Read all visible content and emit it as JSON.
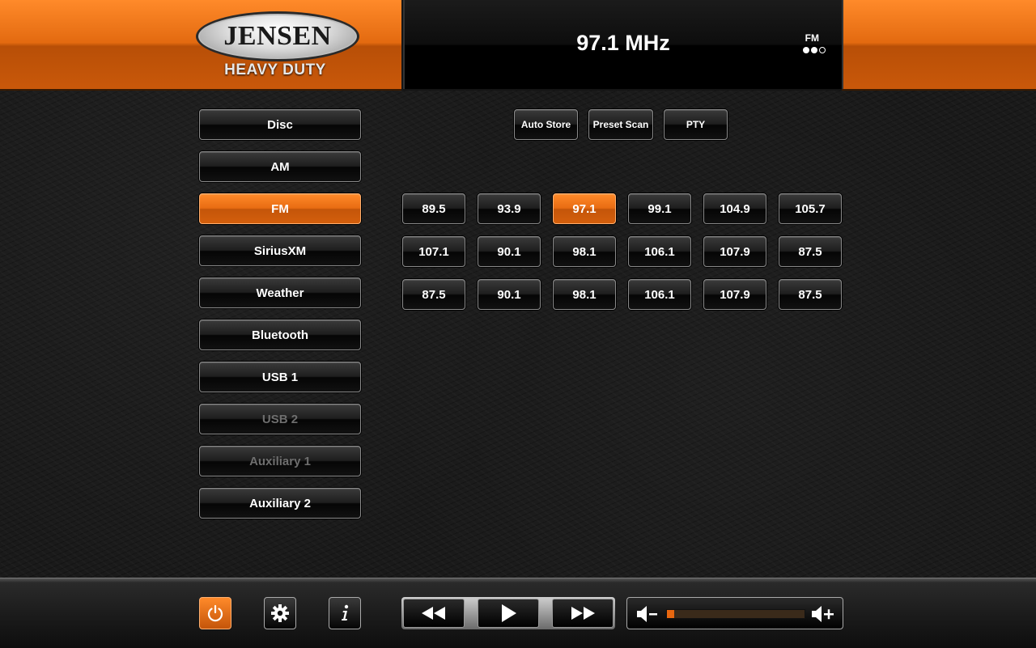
{
  "brand": {
    "name": "JENSEN",
    "subtitle": "HEAVY DUTY"
  },
  "display": {
    "frequency": "97.1 MHz",
    "band": "FM",
    "band_dots": [
      true,
      true,
      false
    ]
  },
  "sources": [
    {
      "label": "Disc",
      "state": "normal"
    },
    {
      "label": "AM",
      "state": "normal"
    },
    {
      "label": "FM",
      "state": "active"
    },
    {
      "label": "SiriusXM",
      "state": "normal"
    },
    {
      "label": "Weather",
      "state": "normal"
    },
    {
      "label": "Bluetooth",
      "state": "normal"
    },
    {
      "label": "USB 1",
      "state": "normal"
    },
    {
      "label": "USB 2",
      "state": "disabled"
    },
    {
      "label": "Auxiliary 1",
      "state": "disabled"
    },
    {
      "label": "Auxiliary 2",
      "state": "normal"
    }
  ],
  "tuner_buttons": {
    "auto_store": "Auto Store",
    "preset_scan": "Preset Scan",
    "pty": "PTY"
  },
  "presets": [
    [
      "89.5",
      "93.9",
      "97.1",
      "99.1",
      "104.9",
      "105.7"
    ],
    [
      "107.1",
      "90.1",
      "98.1",
      "106.1",
      "107.9",
      "87.5"
    ],
    [
      "87.5",
      "90.1",
      "98.1",
      "106.1",
      "107.9",
      "87.5"
    ]
  ],
  "active_preset": "97.1",
  "footer": {
    "icons": [
      "power-icon",
      "gear-icon",
      "info-icon",
      "rewind-icon",
      "play-icon",
      "fast-forward-icon",
      "volume-down-icon",
      "volume-up-icon"
    ],
    "volume_level": 0.05
  },
  "colors": {
    "accent": "#e86c12",
    "background": "#1a1a1a"
  }
}
